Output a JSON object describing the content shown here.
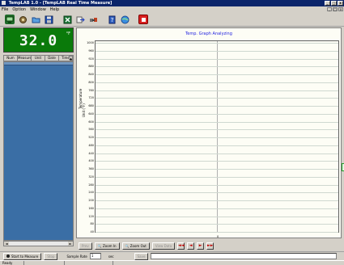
{
  "window": {
    "title": "TempLAB 1.0 - [TempLAB Real Time Measure]",
    "min_label": "_",
    "max_label": "□",
    "close_label": "x"
  },
  "menu": [
    "File",
    "Option",
    "Window",
    "Help"
  ],
  "mdi": {
    "min_label": "_",
    "max_label": "□",
    "close_label": "x"
  },
  "toolbar": {
    "icons": [
      "monitor-icon",
      "settings-icon",
      "open-icon",
      "save-icon",
      "excel-icon",
      "export-icon",
      "connect-icon",
      "help-icon",
      "globe-icon",
      "exit-icon"
    ]
  },
  "display": {
    "value": "32.0",
    "unit": "°F"
  },
  "table": {
    "columns": [
      "Num",
      "Measure",
      "Unit",
      "Date",
      "Time"
    ]
  },
  "chart": {
    "title": "Temp. Graph Analyzing",
    "y_axis_label": "Temperature",
    "unit_label": "Unit (°F)",
    "y_ticks": [
      "1000",
      "960",
      "920",
      "880",
      "840",
      "800",
      "760",
      "720",
      "680",
      "640",
      "600",
      "560",
      "520",
      "480",
      "440",
      "400",
      "360",
      "320",
      "280",
      "240",
      "200",
      "160",
      "120",
      "80",
      "40"
    ],
    "x_tick": "0"
  },
  "chart_buttons": {
    "prev": "Prev",
    "zoom_in": "Zoom In",
    "zoom_out": "Zoom Out",
    "view_all": "View Data",
    "nav": [
      "◄◄",
      "◄",
      "►",
      "►►"
    ]
  },
  "bottom": {
    "start": "Start to Measure",
    "stop": "Stop",
    "sample_rate_label": "Sample Rate",
    "sample_rate_value": "1",
    "sample_unit": "sec",
    "save_btn": "Save",
    "file_field": ""
  },
  "status": [
    "Ready",
    "",
    ""
  ]
}
